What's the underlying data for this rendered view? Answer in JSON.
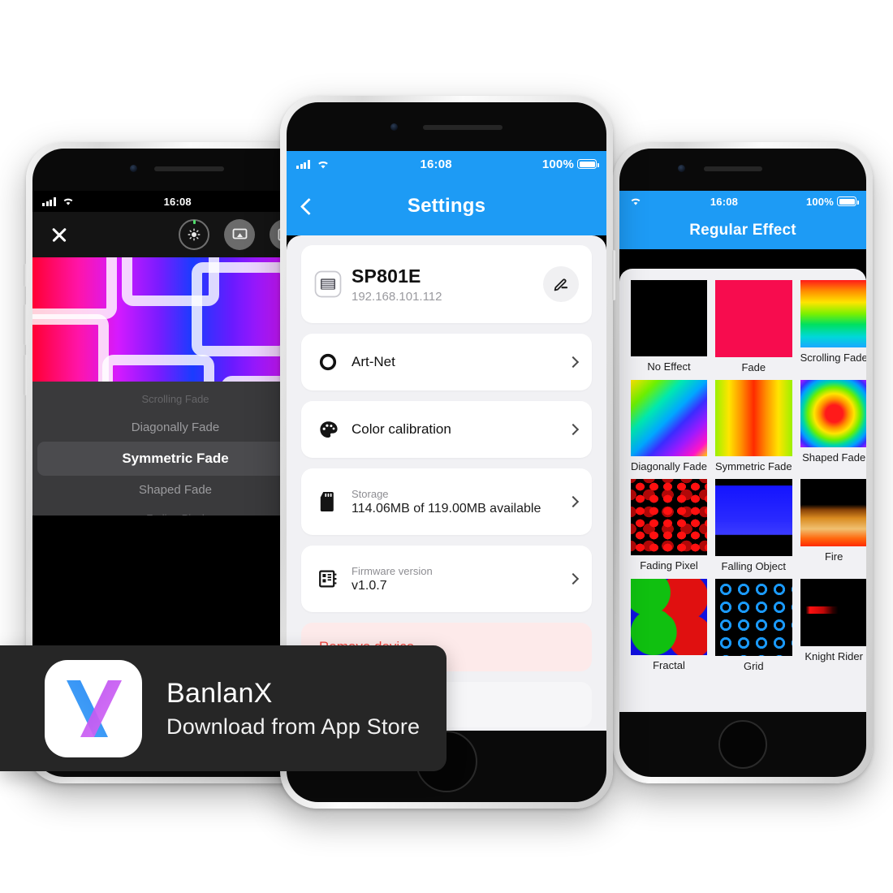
{
  "status_bar": {
    "time": "16:08",
    "battery_percent": "100%",
    "signal_icon": "cellular-signal-icon",
    "wifi_icon": "wifi-icon",
    "battery_icon": "battery-icon"
  },
  "left_phone": {
    "toolbar": {
      "close_icon": "close-icon",
      "brightness_icon": "brightness-dial-icon",
      "cast_icon": "airplay-cast-icon",
      "layout_icon": "layout-grid-icon"
    },
    "art": {
      "name": "led-pixel-art-preview",
      "description": "pixelated ring pattern over red-magenta-blue gradient"
    },
    "picker": {
      "options": [
        "Scrolling Fade",
        "Diagonally Fade",
        "Symmetric Fade",
        "Shaped Fade",
        "Fading Pixel"
      ],
      "selected": "Symmetric Fade",
      "selected_index": 2
    }
  },
  "center_phone": {
    "nav": {
      "title": "Settings",
      "back_icon": "back-chevron-icon"
    },
    "device": {
      "icon": "led-controller-icon",
      "name": "SP801E",
      "ip": "192.168.101.112",
      "edit_icon": "pencil-edit-icon"
    },
    "rows": [
      {
        "icon": "artnet-ring-icon",
        "label": "Art-Net",
        "chevron": "chevron-right-icon"
      },
      {
        "icon": "color-palette-icon",
        "label": "Color calibration",
        "chevron": "chevron-right-icon"
      }
    ],
    "detail_rows": [
      {
        "icon": "sd-card-icon",
        "title": "Storage",
        "value": "114.06MB of 119.00MB available",
        "chevron": "chevron-right-icon"
      },
      {
        "icon": "firmware-chip-icon",
        "title": "Firmware version",
        "value": "v1.0.7",
        "chevron": "chevron-right-icon"
      }
    ],
    "danger": {
      "label": "Remove device",
      "color": "#f0443e"
    }
  },
  "right_phone": {
    "nav": {
      "title": "Regular Effect"
    },
    "effects": [
      {
        "label": "No Effect",
        "thumb": "no-effect-thumb"
      },
      {
        "label": "Fade",
        "thumb": "fade-thumb"
      },
      {
        "label": "Scrolling Fade",
        "thumb": "scrolling-fade-thumb"
      },
      {
        "label": "Diagonally Fade",
        "thumb": "diagonally-fade-thumb"
      },
      {
        "label": "Symmetric Fade",
        "thumb": "symmetric-fade-thumb"
      },
      {
        "label": "Shaped Fade",
        "thumb": "shaped-fade-thumb"
      },
      {
        "label": "Fading Pixel",
        "thumb": "fading-pixel-thumb"
      },
      {
        "label": "Falling Object",
        "thumb": "falling-object-thumb"
      },
      {
        "label": "Fire",
        "thumb": "fire-thumb"
      },
      {
        "label": "Fractal",
        "thumb": "fractal-thumb"
      },
      {
        "label": "Grid",
        "thumb": "grid-thumb"
      },
      {
        "label": "Knight Rider",
        "thumb": "knight-rider-thumb"
      }
    ]
  },
  "badge": {
    "app_name": "BanlanX",
    "cta": "Download from App Store",
    "logo_icon": "banlanx-x-logo-icon"
  },
  "colors": {
    "accent": "#1d9bf5",
    "danger": "#f0443e",
    "page_bg": "#f1f1f4"
  }
}
